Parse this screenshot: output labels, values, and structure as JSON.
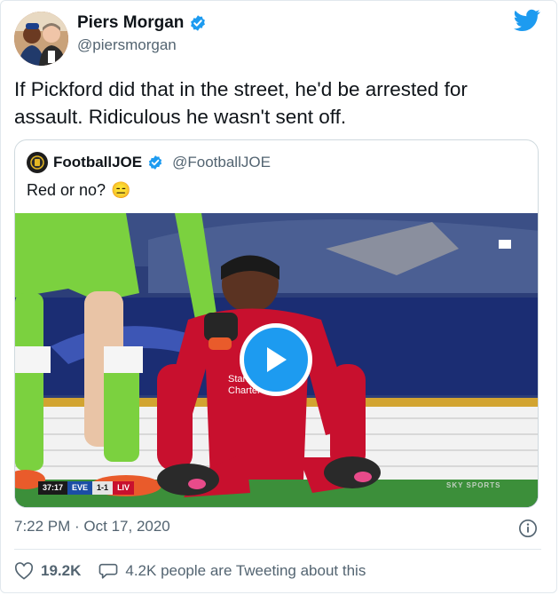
{
  "author": {
    "name": "Piers Morgan",
    "handle": "@piersmorgan"
  },
  "tweet": {
    "text": "If Pickford did that in the street, he'd be arrested for assault. Ridiculous he wasn't sent off."
  },
  "quoted": {
    "name": "FootballJOE",
    "handle": "@FootballJOE",
    "text": "Red or no?",
    "emoji": "😑",
    "media": {
      "scorebar": {
        "time": "37:17",
        "home": "EVE",
        "score": "1-1",
        "away": "LIV"
      },
      "watermark": "SKY SPORTS"
    }
  },
  "meta": {
    "timestamp": "7:22 PM · Oct 17, 2020"
  },
  "actions": {
    "likes": "19.2K",
    "replies_text": "4.2K people are Tweeting about this"
  },
  "colors": {
    "twitter_blue": "#1d9bf0",
    "verified": "#1d9bf0",
    "liverpool_red": "#c8102e",
    "keeper_green": "#7bd13f"
  },
  "icons": [
    "twitter-bird-icon",
    "verified-badge-icon",
    "play-icon",
    "info-icon",
    "heart-icon",
    "comment-icon"
  ]
}
